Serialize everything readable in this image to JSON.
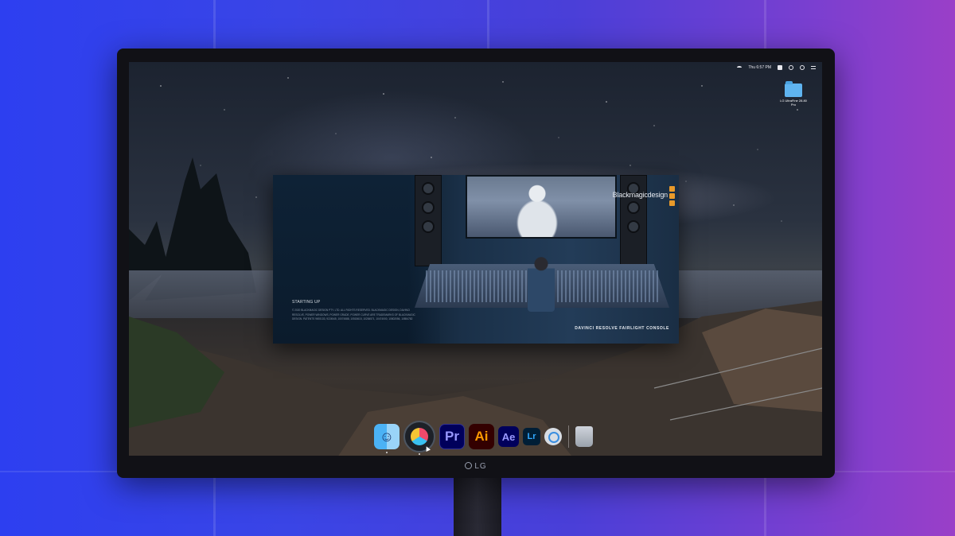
{
  "menubar": {
    "clock": "Thu 6:57 PM"
  },
  "desktop": {
    "folder_label": "LG UltraFine 28.80 Pro"
  },
  "splash": {
    "brand": "Blackmagicdesign",
    "status": "STARTING UP",
    "copyright": "© 2020 BLACKMAGIC DESIGN PTY. LTD. ALL RIGHTS RESERVED. BLACKMAGIC DESIGN, DAVINCI RESOLVE, POWER WINDOWS, POWER GRADE, POWER CURVE ARE TRADEMARKS OF BLACKMAGIC DESIGN. PATENTS 9693133, 9224545, 10074588, 10515615, 10284571, 10474000, 10802056, 10854782",
    "console_title": "DAVINCI RESOLVE FAIRLIGHT CONSOLE",
    "accent": "#e89a2a"
  },
  "dock": {
    "apps": [
      {
        "name": "Finder",
        "icon": "finder-icon"
      },
      {
        "name": "DaVinci Resolve",
        "icon": "davinci-resolve-icon"
      },
      {
        "name": "Premiere Pro",
        "label": "Pr"
      },
      {
        "name": "Illustrator",
        "label": "Ai"
      },
      {
        "name": "After Effects",
        "label": "Ae"
      },
      {
        "name": "Lightroom",
        "label": "Lr"
      },
      {
        "name": "QuickTime",
        "icon": "quicktime-icon"
      },
      {
        "name": "Trash",
        "icon": "trash-icon"
      }
    ]
  },
  "monitor": {
    "brand": "LG"
  }
}
